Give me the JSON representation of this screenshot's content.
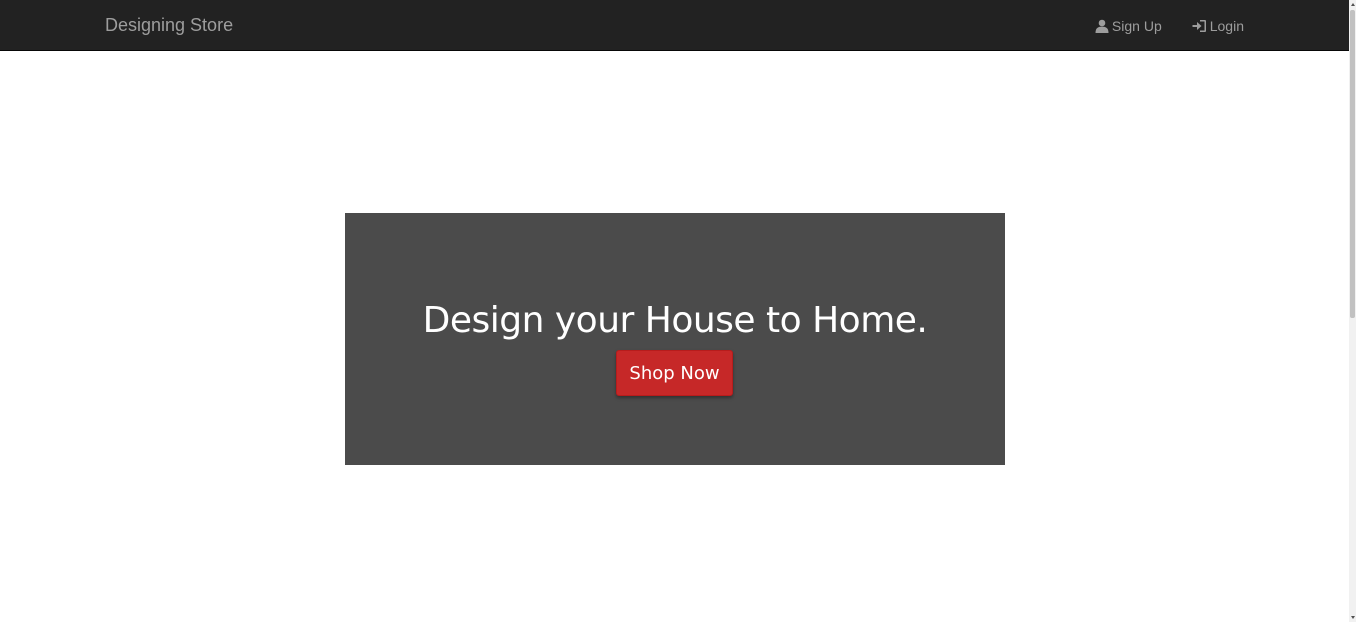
{
  "navbar": {
    "brand": "Designing Store",
    "links": [
      {
        "label": "Sign Up",
        "icon": "user-icon"
      },
      {
        "label": "Login",
        "icon": "login-icon"
      }
    ]
  },
  "hero": {
    "title": "Design your House to Home.",
    "button_label": "Shop Now"
  },
  "colors": {
    "navbar_bg": "#222222",
    "nav_text": "#9d9d9d",
    "hero_bg": "#4b4b4b",
    "button_bg": "#c62828"
  }
}
